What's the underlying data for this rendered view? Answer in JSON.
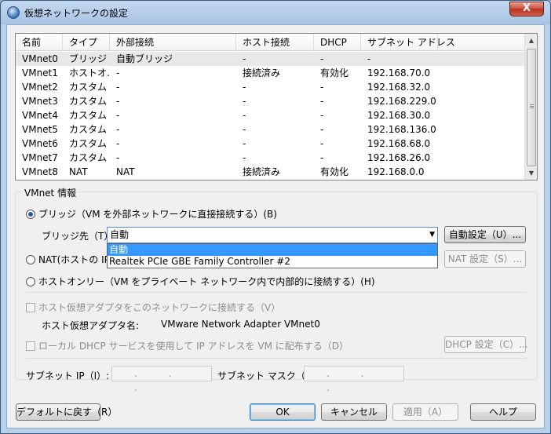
{
  "window": {
    "title": "仮想ネットワークの設定",
    "close_glyph": "X"
  },
  "list": {
    "columns": [
      "名前",
      "タイプ",
      "外部接続",
      "ホスト接続",
      "DHCP",
      "サブネット アドレス"
    ],
    "rows": [
      [
        "VMnet0",
        "ブリッジ",
        "自動ブリッジ",
        "-",
        "-",
        "-"
      ],
      [
        "VMnet1",
        "ホストオ...",
        "-",
        "接続済み",
        "有効化",
        "192.168.70.0"
      ],
      [
        "VMnet2",
        "カスタム",
        "-",
        "-",
        "-",
        "192.168.32.0"
      ],
      [
        "VMnet3",
        "カスタム",
        "-",
        "-",
        "-",
        "192.168.229.0"
      ],
      [
        "VMnet4",
        "カスタム",
        "-",
        "-",
        "-",
        "192.168.30.0"
      ],
      [
        "VMnet5",
        "カスタム",
        "-",
        "-",
        "-",
        "192.168.136.0"
      ],
      [
        "VMnet6",
        "カスタム",
        "-",
        "-",
        "-",
        "192.168.68.0"
      ],
      [
        "VMnet7",
        "カスタム",
        "-",
        "-",
        "-",
        "192.168.26.0"
      ],
      [
        "VMnet8",
        "NAT",
        "NAT",
        "接続済み",
        "有効化",
        "192.168.0.0"
      ]
    ]
  },
  "info": {
    "group_title": "VMnet 情報",
    "bridge_radio": "ブリッジ（VM を外部ネットワークに直接接続する）(B)",
    "bridge_to_label": "ブリッジ先（T）:",
    "bridge_to_value": "自動",
    "auto_settings_button": "自動設定（U）...",
    "dropdown_options": [
      "自動",
      "Realtek PCIe GBE Family Controller #2"
    ],
    "nat_radio": "NAT(ホストの IP",
    "nat_settings_button": "NAT 設定（S）...",
    "hostonly_radio": "ホストオンリー（VM をプライベート ネットワーク内で内部的に接続する）(H)",
    "connect_host_adapter": "ホスト仮想アダプタをこのネットワークに接続する（V）",
    "host_adapter_name_label": "ホスト仮想アダプタ名:",
    "host_adapter_name_value": "VMware Network Adapter VMnet0",
    "use_dhcp": "ローカル DHCP サービスを使用して IP アドレスを VM に配布する（D）",
    "dhcp_settings_button": "DHCP 設定（C）...",
    "subnet_ip_label": "サブネット IP（I）:",
    "subnet_ip_value": ". . .",
    "subnet_mask_label": "サブネット マスク（M）:",
    "subnet_mask_value": ". . ."
  },
  "footer": {
    "restore_defaults": "デフォルトに戻す（R）",
    "ok": "OK",
    "cancel": "キャンセル",
    "apply": "適用（A）",
    "help": "ヘルプ"
  }
}
